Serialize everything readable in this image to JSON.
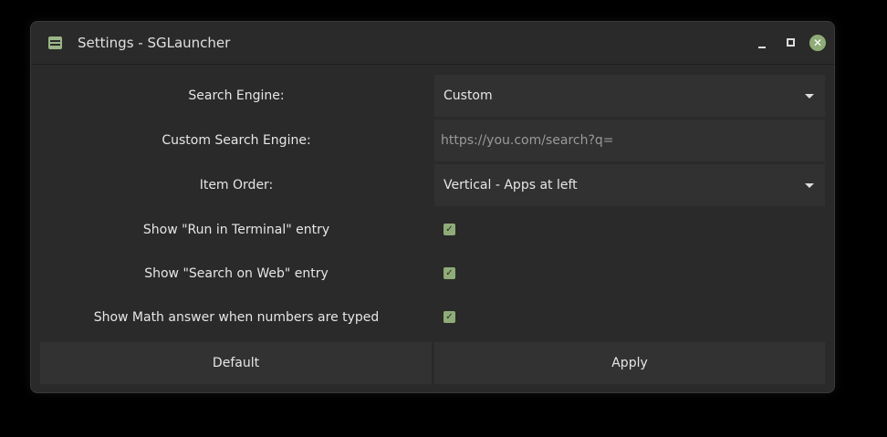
{
  "window": {
    "title": "Settings - SGLauncher",
    "accent": "#8fac78"
  },
  "settings": [
    {
      "label": "Search Engine:",
      "type": "dropdown",
      "value": "Custom"
    },
    {
      "label": "Custom Search Engine:",
      "type": "text",
      "placeholder": "https://you.com/search?q="
    },
    {
      "label": "Item Order:",
      "type": "dropdown",
      "value": "Vertical - Apps at left"
    },
    {
      "label": "Show \"Run in Terminal\" entry",
      "type": "checkbox",
      "checked": true
    },
    {
      "label": "Show \"Search on Web\" entry",
      "type": "checkbox",
      "checked": true
    },
    {
      "label": "Show Math answer when numbers are typed",
      "type": "checkbox",
      "checked": true
    }
  ],
  "buttons": {
    "default": "Default",
    "apply": "Apply"
  }
}
